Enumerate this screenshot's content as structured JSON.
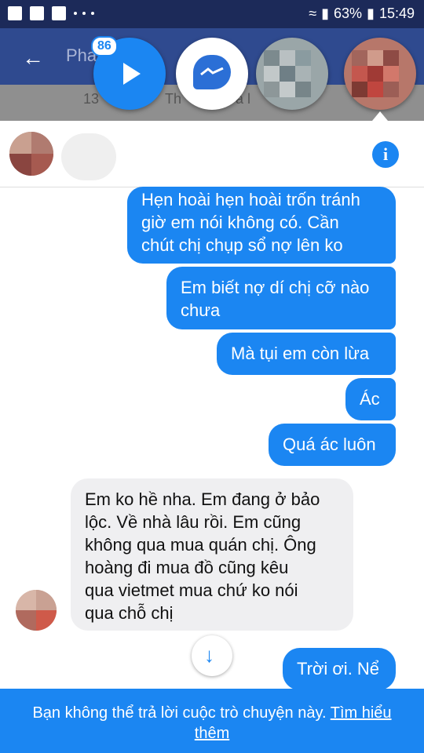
{
  "status_bar": {
    "battery": "63%",
    "time": "15:49",
    "icons": [
      "gallery-icon",
      "facebook-icon",
      "checkmark-icon",
      "more-icon",
      "wifi-icon",
      "signal-icon",
      "battery-icon"
    ]
  },
  "app_bar": {
    "title_visible_part": "Pha",
    "subbar_left": "13",
    "subbar_mid": "Th",
    "subbar_right": "à l"
  },
  "chat_heads": {
    "badge_count": "86",
    "heads": [
      "video-play-head",
      "messenger-head",
      "contact-head-blurred",
      "contact-head-blurred"
    ]
  },
  "conversation": {
    "messages": [
      {
        "direction": "out",
        "text": "Hẹn hoài hẹn hoài trốn tránh\ngiờ em nói không có. Cần\nchút chị chụp sổ nợ lên ko"
      },
      {
        "direction": "out",
        "text": "Em biết nợ dí chị cỡ nào\nchưa"
      },
      {
        "direction": "out",
        "text": "Mà tụi em còn lừa"
      },
      {
        "direction": "out",
        "text": "Ác"
      },
      {
        "direction": "out",
        "text": "Quá ác luôn"
      },
      {
        "direction": "in",
        "text": "Em ko hề nha. Em đang ở bảo\nlộc. Về nhà lâu rồi. Em cũng\nkhông qua mua quán chị. Ông\nhoàng đi mua đồ cũng kêu\nqua vietmet mua chứ ko nói\nqua chỗ chị"
      },
      {
        "direction": "out",
        "text": "Trời ơi. Nể"
      }
    ]
  },
  "footer": {
    "notice": "Bạn không thể trả lời cuộc trò chuyện này. ",
    "link": "Tìm hiểu thêm"
  },
  "colors": {
    "accent": "#1b86f2",
    "status_bar": "#1c2a59",
    "app_bar": "#2f4a8f",
    "incoming_bubble": "#efeff1"
  }
}
